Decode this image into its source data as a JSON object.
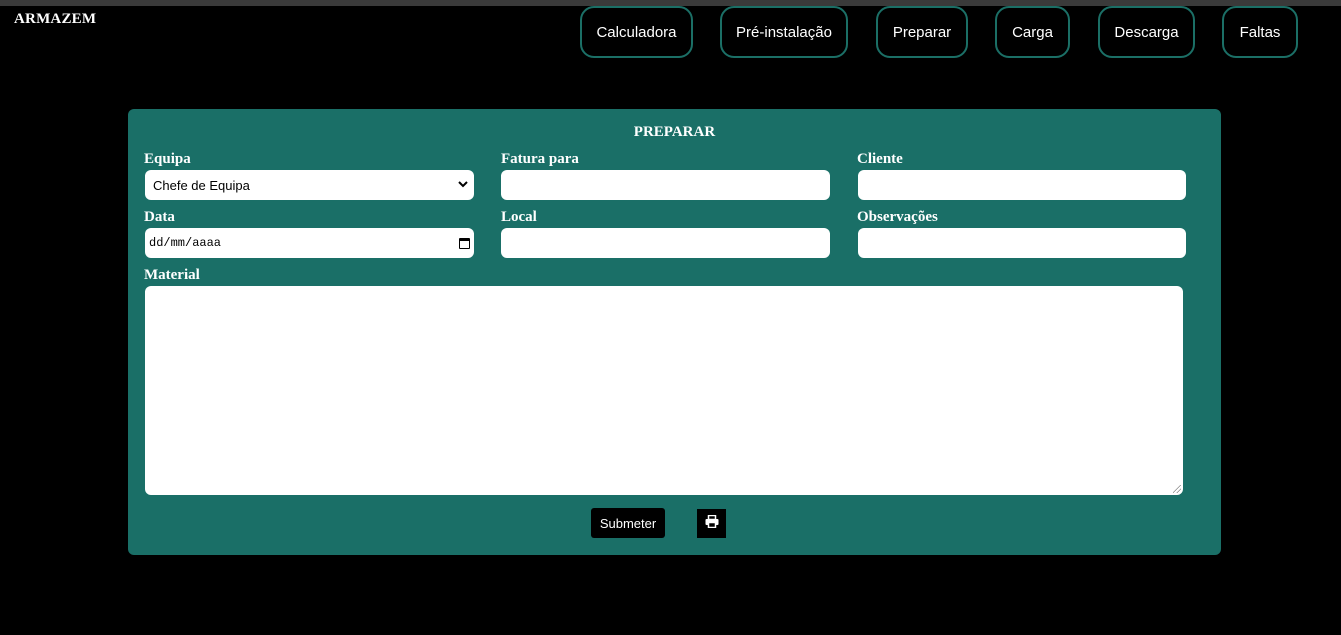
{
  "brand": "ARMAZEM",
  "nav": {
    "calculadora": "Calculadora",
    "pre_instalacao": "Pré-instalação",
    "preparar": "Preparar",
    "carga": "Carga",
    "descarga": "Descarga",
    "faltas": "Faltas"
  },
  "form": {
    "title": "PREPARAR",
    "equipa": {
      "label": "Equipa",
      "value": "Chefe de Equipa"
    },
    "fatura_para": {
      "label": "Fatura para",
      "value": ""
    },
    "cliente": {
      "label": "Cliente",
      "value": ""
    },
    "data": {
      "label": "Data",
      "placeholder": "dd/mm/aaaa"
    },
    "local": {
      "label": "Local",
      "value": ""
    },
    "observacoes": {
      "label": "Observações",
      "value": ""
    },
    "material": {
      "label": "Material",
      "value": ""
    },
    "submit_label": "Submeter"
  },
  "icons": {
    "print": "print-icon",
    "select_chevron": "chevron-down-icon",
    "calendar": "calendar-icon"
  },
  "colors": {
    "background": "#000000",
    "panel": "#1a6f67",
    "nav_border": "#1b6f66",
    "text": "#ffffff"
  }
}
